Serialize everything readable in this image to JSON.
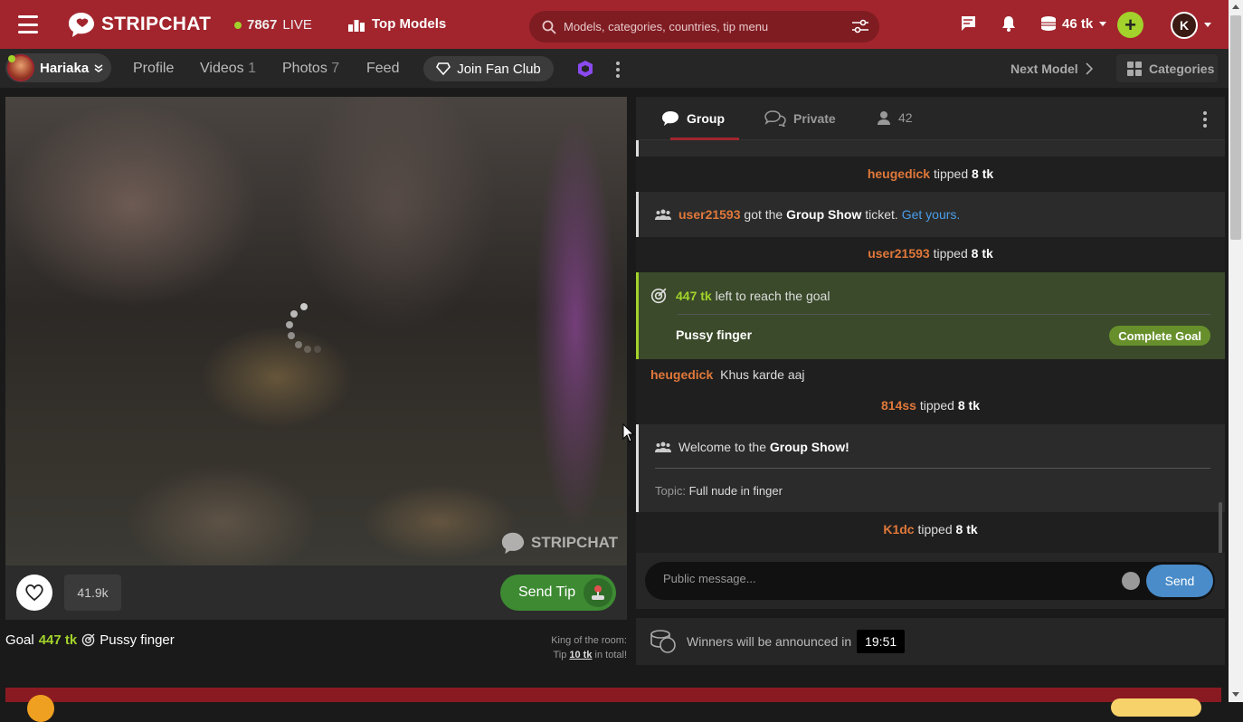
{
  "header": {
    "logo_text": "STRIPCHAT",
    "live_count": "7867",
    "live_label": "LIVE",
    "top_models": "Top Models",
    "search_placeholder": "Models, categories, countries, tip menu",
    "tokens": "46 tk",
    "avatar_letter": "K",
    "plus": "+"
  },
  "subnav": {
    "model_name": "Hariaka",
    "profile": "Profile",
    "videos": "Videos",
    "videos_count": "1",
    "photos": "Photos",
    "photos_count": "7",
    "feed": "Feed",
    "fan_club": "Join Fan Club",
    "next_model": "Next Model",
    "categories": "Categories"
  },
  "video": {
    "watermark": "STRIPCHAT",
    "likes": "41.9k",
    "send_tip": "Send Tip"
  },
  "goal": {
    "label": "Goal",
    "amount": "447 tk",
    "name": "Pussy finger"
  },
  "king": {
    "line1": "King of the room:",
    "tip": "Tip",
    "amount": "10 tk",
    "suffix": "in total!"
  },
  "chat": {
    "tabs": {
      "group": "Group",
      "private": "Private",
      "users": "42"
    },
    "messages": {
      "m1_user": "heugedick",
      "m1_text": "tipped",
      "m1_amount": "8 tk",
      "m2_user": "user21593",
      "m2_text1": "got the",
      "m2_show": "Group Show",
      "m2_text2": "ticket.",
      "m2_link": "Get yours.",
      "m3_user": "user21593",
      "m3_text": "tipped",
      "m3_amount": "8 tk",
      "goal_amount": "447 tk",
      "goal_text": "left to reach the goal",
      "goal_name": "Pussy finger",
      "goal_btn": "Complete Goal",
      "m4_user": "heugedick",
      "m4_text": "Khus karde aaj",
      "m5_user": "814ss",
      "m5_text": "tipped",
      "m5_amount": "8 tk",
      "welcome_text": "Welcome to the",
      "welcome_show": "Group Show!",
      "topic_label": "Topic:",
      "topic_text": "Full nude in finger",
      "m6_user": "K1dc",
      "m6_text": "tipped",
      "m6_amount": "8 tk"
    },
    "composer_placeholder": "Public message...",
    "send": "Send"
  },
  "winners": {
    "text": "Winners will be announced in",
    "timer": "19:51"
  },
  "colors": {
    "brand": "#a2252d",
    "accent_green": "#a2d22b",
    "username": "#e0783a"
  }
}
